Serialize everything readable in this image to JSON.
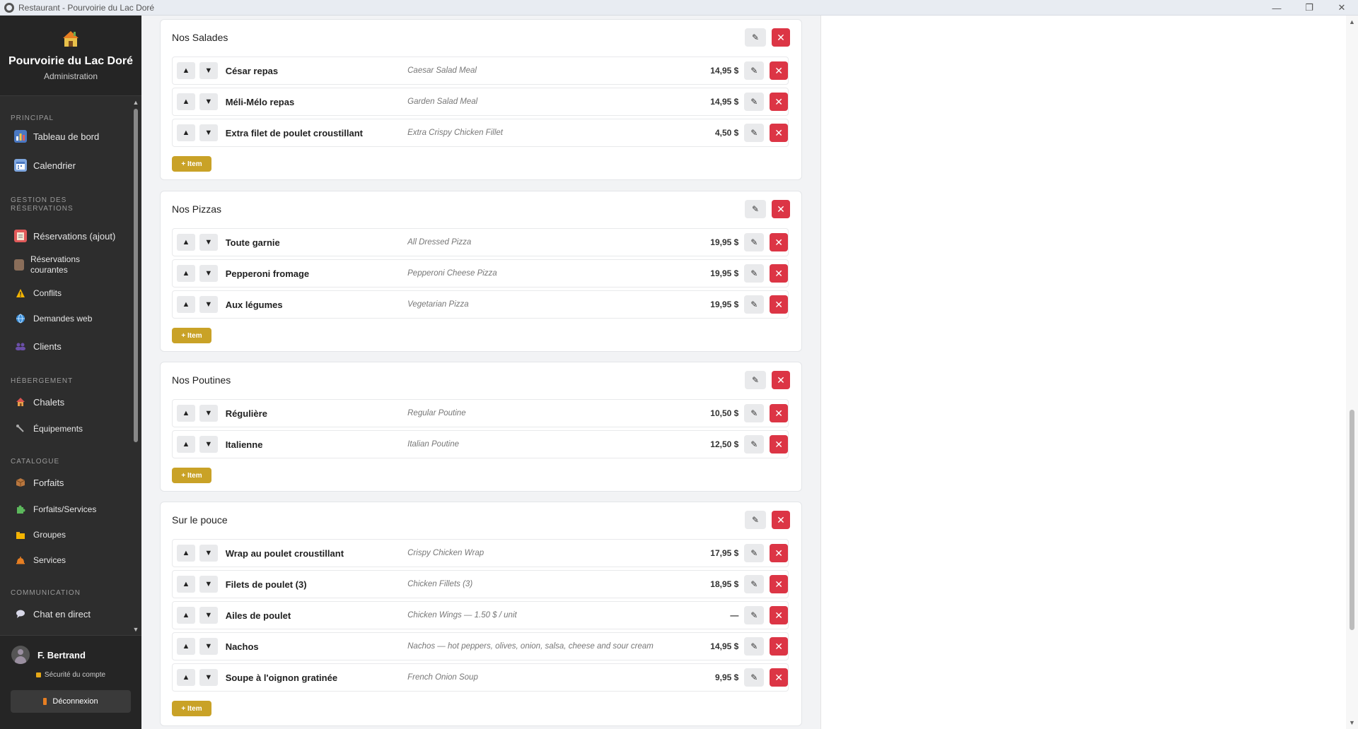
{
  "window": {
    "title": "Restaurant - Pourvoirie du Lac Doré",
    "minimize": "—",
    "maximize": "❐",
    "close": "✕"
  },
  "brand": {
    "name": "Pourvoirie du Lac Doré",
    "subtitle": "Administration"
  },
  "nav": {
    "principal": "PRINCIPAL",
    "dashboard": "Tableau de bord",
    "calendar": "Calendrier",
    "reservations_section": "GESTION DES RÉSERVATIONS",
    "reservations_add": "Réservations (ajout)",
    "reservations_current": "Réservations courantes",
    "conflicts": "Conflits",
    "web_requests": "Demandes web",
    "clients": "Clients",
    "lodging_section": "HÉBERGEMENT",
    "chalets": "Chalets",
    "equipment": "Équipements",
    "catalog_section": "CATALOGUE",
    "packages": "Forfaits",
    "packages_services": "Forfaits/Services",
    "groups": "Groupes",
    "services": "Services",
    "communication_section": "COMMUNICATION",
    "live_chat": "Chat en direct"
  },
  "user": {
    "name": "F. Bertrand",
    "security": "Sécurité du compte",
    "logout": "Déconnexion"
  },
  "add_label": "+ Item",
  "categories": [
    {
      "title": "Nos Salades",
      "items": [
        {
          "name": "César repas",
          "en": "Caesar Salad Meal",
          "price": "14,95 $"
        },
        {
          "name": "Méli-Mélo repas",
          "en": "Garden Salad Meal",
          "price": "14,95 $"
        },
        {
          "name": "Extra filet de poulet croustillant",
          "en": "Extra Crispy Chicken Fillet",
          "price": "4,50 $"
        }
      ]
    },
    {
      "title": "Nos Pizzas",
      "items": [
        {
          "name": "Toute garnie",
          "en": "All Dressed Pizza",
          "price": "19,95 $"
        },
        {
          "name": "Pepperoni fromage",
          "en": "Pepperoni Cheese Pizza",
          "price": "19,95 $"
        },
        {
          "name": "Aux légumes",
          "en": "Vegetarian Pizza",
          "price": "19,95 $"
        }
      ]
    },
    {
      "title": "Nos Poutines",
      "items": [
        {
          "name": "Régulière",
          "en": "Regular Poutine",
          "price": "10,50 $"
        },
        {
          "name": "Italienne",
          "en": "Italian Poutine",
          "price": "12,50 $"
        }
      ]
    },
    {
      "title": "Sur le pouce",
      "items": [
        {
          "name": "Wrap au poulet croustillant",
          "en": "Crispy Chicken Wrap",
          "price": "17,95 $"
        },
        {
          "name": "Filets de poulet (3)",
          "en": "Chicken Fillets (3)",
          "price": "18,95 $"
        },
        {
          "name": "Ailes de poulet",
          "en": "Chicken Wings — 1.50 $ / unit",
          "price": "—"
        },
        {
          "name": "Nachos",
          "en": "Nachos — hot peppers, olives, onion, salsa, cheese and sour cream",
          "price": "14,95 $"
        },
        {
          "name": "Soupe à l'oignon gratinée",
          "en": "French Onion Soup",
          "price": "9,95 $"
        }
      ]
    }
  ],
  "icons": {
    "edit": "pencil-icon",
    "delete": "close-icon",
    "up": "arrow-up-icon",
    "down": "arrow-down-icon"
  },
  "colors": {
    "sidebar": "#2d2d2d",
    "danger": "#dc3545",
    "accent": "#c9a227"
  }
}
